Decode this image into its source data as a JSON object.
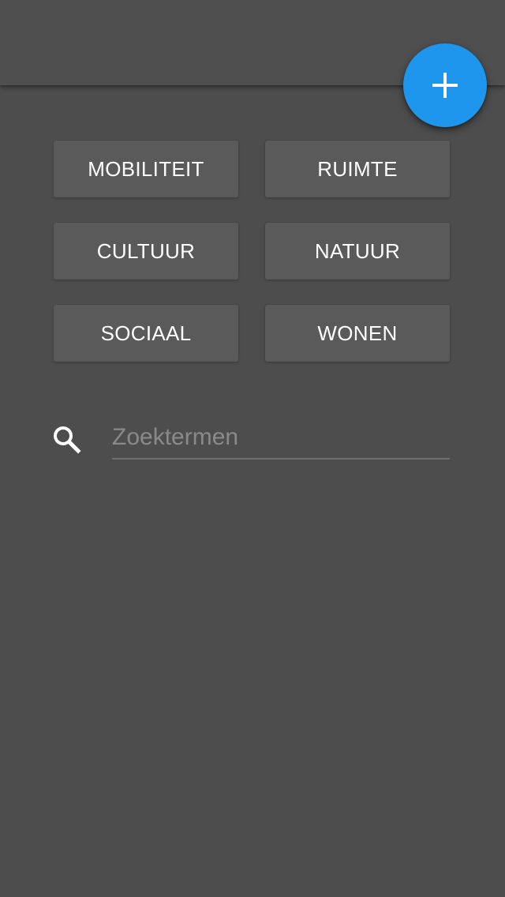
{
  "toolbar": {
    "title": ""
  },
  "fab": {
    "icon": "plus-icon",
    "color": "#1e96ee"
  },
  "categories": [
    {
      "label": "MOBILITEIT"
    },
    {
      "label": "RUIMTE"
    },
    {
      "label": "CULTUUR"
    },
    {
      "label": "NATUUR"
    },
    {
      "label": "SOCIAAL"
    },
    {
      "label": "WONEN"
    }
  ],
  "search": {
    "icon": "search-icon",
    "value": "",
    "placeholder": "Zoektermen"
  },
  "colors": {
    "background": "#4d4d4d",
    "button": "#5a5a5a",
    "accent": "#1e96ee"
  }
}
